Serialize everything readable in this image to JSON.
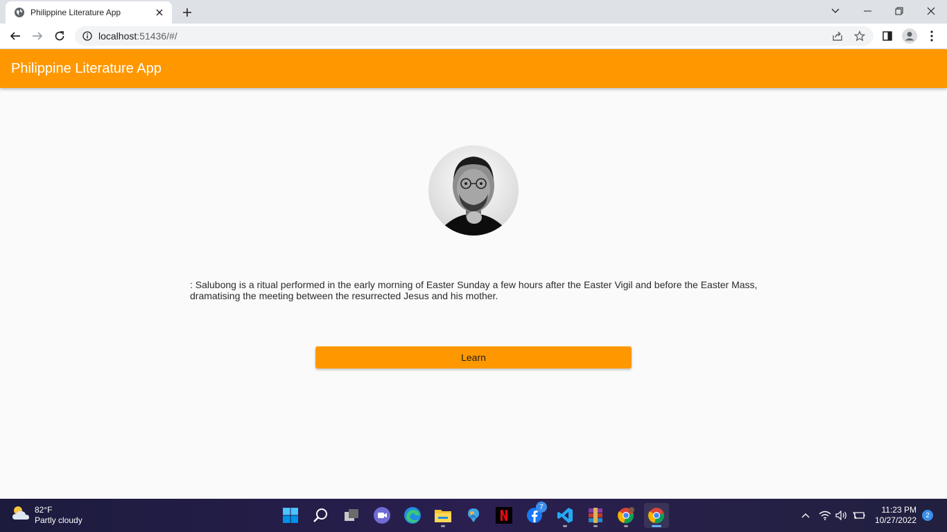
{
  "browser": {
    "tab_title": "Philippine Literature App",
    "url_host": "localhost",
    "url_path": ":51436/#/"
  },
  "app": {
    "title": "Philippine Literature App",
    "description": ": Salubong is a ritual performed in the early morning of Easter Sunday a few hours after the Easter Vigil and before the Easter Mass, dramatising the meeting between the resurrected Jesus and his mother.",
    "learn_button": "Learn",
    "accent_color": "#ff9800"
  },
  "taskbar": {
    "weather_temp": "82°F",
    "weather_desc": "Partly cloudy",
    "time": "11:23 PM",
    "date": "10/27/2022",
    "notification_count": "2",
    "facebook_badge": "7",
    "pinned": [
      "windows-start",
      "search",
      "task-view",
      "teams-chat",
      "edge",
      "file-explorer",
      "photos",
      "netflix",
      "facebook",
      "vs-code",
      "winrar",
      "chrome-profile",
      "chrome"
    ]
  }
}
